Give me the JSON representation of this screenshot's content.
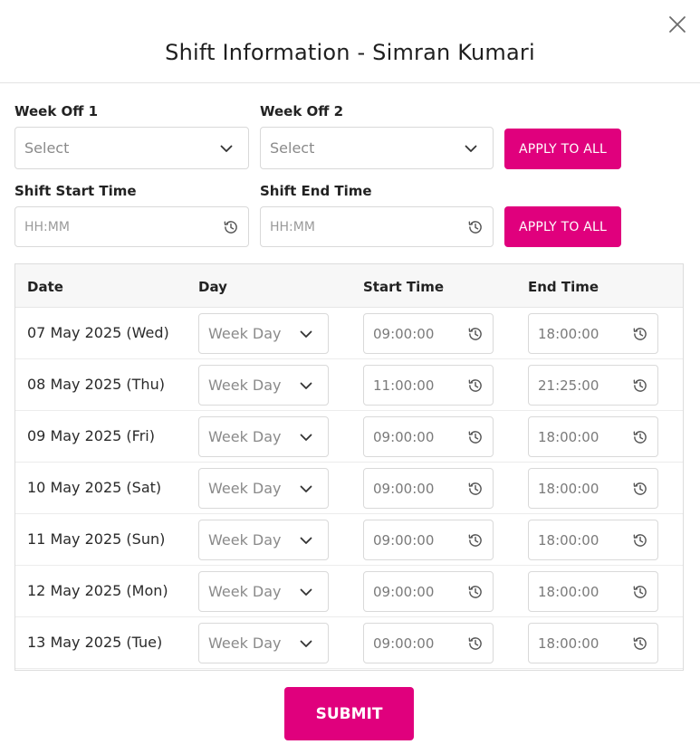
{
  "modal": {
    "title": "Shift Information - Simran Kumari",
    "close_icon": "close-icon"
  },
  "week_off": {
    "week_off_1_label": "Week Off 1",
    "week_off_1_value": "Select",
    "week_off_2_label": "Week Off 2",
    "week_off_2_value": "Select",
    "apply_label": "APPLY TO ALL"
  },
  "shift_time": {
    "start_label": "Shift Start Time",
    "start_placeholder": "HH:MM",
    "end_label": "Shift End Time",
    "end_placeholder": "HH:MM",
    "apply_label": "APPLY TO ALL"
  },
  "table": {
    "headers": {
      "date": "Date",
      "day": "Day",
      "start": "Start Time",
      "end": "End Time"
    },
    "rows": [
      {
        "date": "07 May 2025 (Wed)",
        "day": "Week Day",
        "start": "09:00:00",
        "end": "18:00:00"
      },
      {
        "date": "08 May 2025 (Thu)",
        "day": "Week Day",
        "start": "11:00:00",
        "end": "21:25:00"
      },
      {
        "date": "09 May 2025 (Fri)",
        "day": "Week Day",
        "start": "09:00:00",
        "end": "18:00:00"
      },
      {
        "date": "10 May 2025 (Sat)",
        "day": "Week Day",
        "start": "09:00:00",
        "end": "18:00:00"
      },
      {
        "date": "11 May 2025 (Sun)",
        "day": "Week Day",
        "start": "09:00:00",
        "end": "18:00:00"
      },
      {
        "date": "12 May 2025 (Mon)",
        "day": "Week Day",
        "start": "09:00:00",
        "end": "18:00:00"
      },
      {
        "date": "13 May 2025 (Tue)",
        "day": "Week Day",
        "start": "09:00:00",
        "end": "18:00:00"
      }
    ]
  },
  "submit_label": "SUBMIT",
  "colors": {
    "accent": "#e0007d",
    "border": "#d9d9d9",
    "header_bg": "#f7f7f7"
  },
  "icons": {
    "dropdown": "chevron-down-icon",
    "time": "history-clock-icon"
  }
}
